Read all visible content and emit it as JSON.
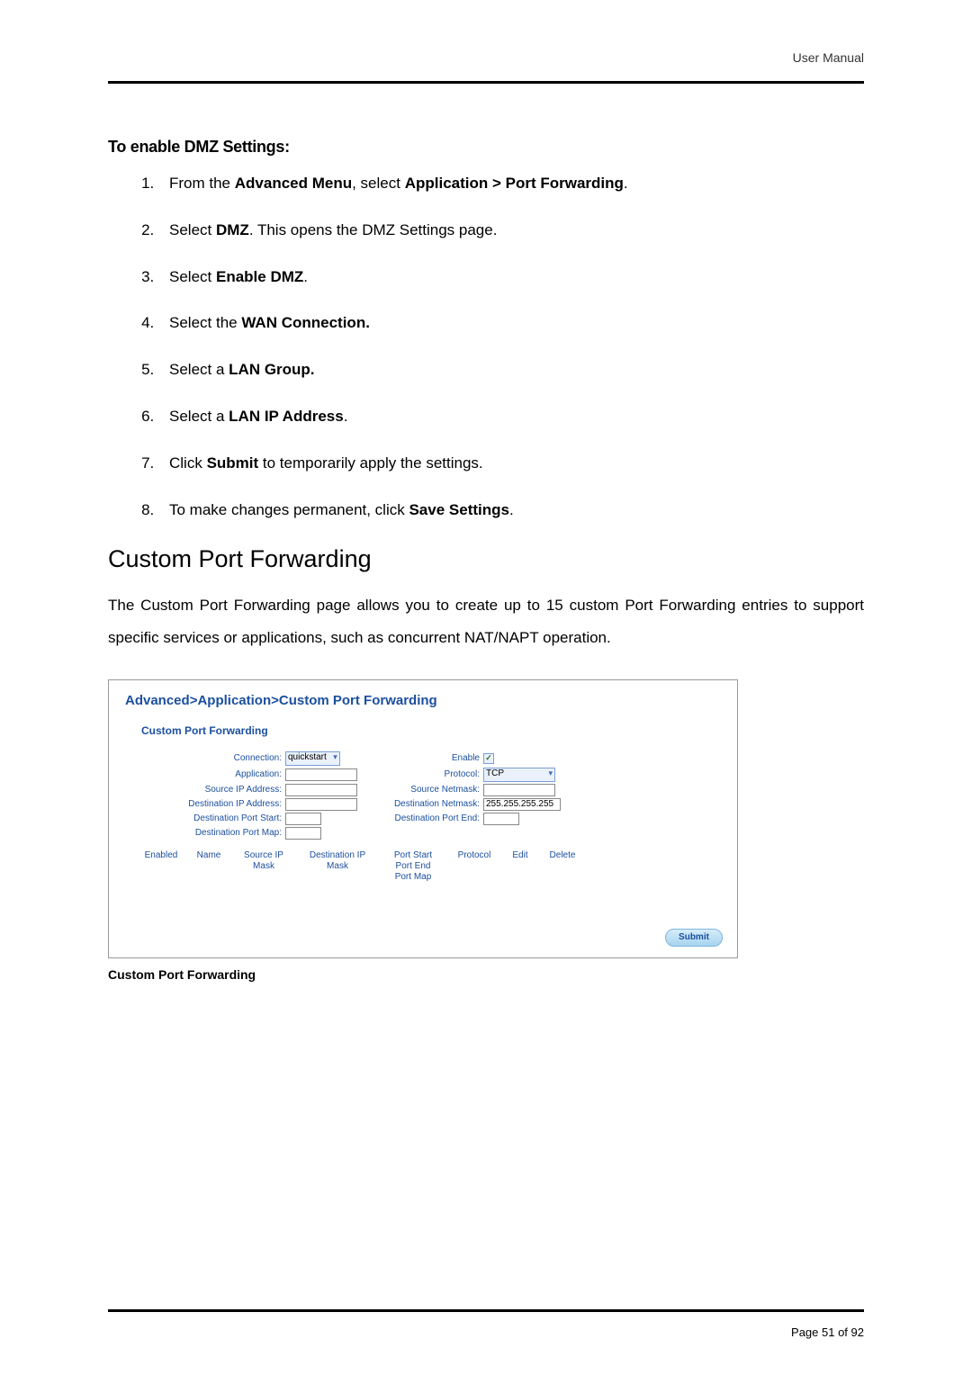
{
  "header": {
    "label": "User Manual"
  },
  "section_title": "To enable DMZ Settings:",
  "steps": [
    {
      "pre": "From the ",
      "b1": "Advanced Menu",
      "mid": ", select ",
      "b2": "Application > Port Forwarding",
      "post": "."
    },
    {
      "pre": "Select ",
      "b1": "DMZ",
      "mid": ". This opens the DMZ Settings page.",
      "b2": "",
      "post": ""
    },
    {
      "pre": "Select ",
      "b1": "Enable DMZ",
      "mid": ".",
      "b2": "",
      "post": ""
    },
    {
      "pre": "Select the ",
      "b1": "WAN Connection.",
      "mid": "",
      "b2": "",
      "post": ""
    },
    {
      "pre": "Select a ",
      "b1": "LAN Group.",
      "mid": "",
      "b2": "",
      "post": ""
    },
    {
      "pre": "Select a ",
      "b1": "LAN IP Address",
      "mid": ".",
      "b2": "",
      "post": ""
    },
    {
      "pre": "Click ",
      "b1": "Submit",
      "mid": " to temporarily apply the settings.",
      "b2": "",
      "post": ""
    },
    {
      "pre": "To make changes permanent, click ",
      "b1": "Save Settings",
      "mid": ".",
      "b2": "",
      "post": ""
    }
  ],
  "subheading": "Custom Port Forwarding",
  "paragraph": "The Custom Port Forwarding page allows you to create up to 15 custom Port Forwarding entries to support specific services or applications, such as concurrent NAT/NAPT operation.",
  "screenshot": {
    "breadcrumb": "Advanced>Application>Custom Port Forwarding",
    "panel_title": "Custom Port Forwarding",
    "labels": {
      "connection": "Connection:",
      "enable": "Enable",
      "application": "Application:",
      "protocol": "Protocol:",
      "source_ip": "Source IP Address:",
      "source_netmask": "Source Netmask:",
      "dest_ip": "Destination IP Address:",
      "dest_netmask": "Destination Netmask:",
      "dest_port_start": "Destination Port Start:",
      "dest_port_end": "Destination Port End:",
      "dest_port_map": "Destination Port Map:"
    },
    "values": {
      "connection": "quickstart",
      "protocol": "TCP",
      "dest_netmask": "255.255.255.255",
      "enable_checked": "✓"
    },
    "table_headers": [
      "Enabled",
      "Name",
      "Source IP\nMask",
      "Destination IP\nMask",
      "Port Start\nPort End\nPort Map",
      "Protocol",
      "Edit",
      "Delete"
    ],
    "submit": "Submit"
  },
  "caption": "Custom Port Forwarding",
  "footer": {
    "page": "Page 51 of 92"
  }
}
